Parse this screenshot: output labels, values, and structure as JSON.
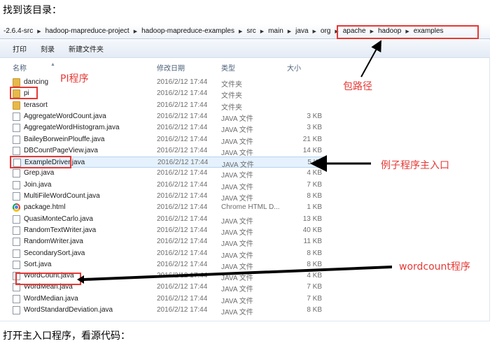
{
  "headings": {
    "top": "找到该目录：",
    "bottom": "打开主入口程序，看源代码："
  },
  "breadcrumb": [
    "-2.6.4-src",
    "hadoop-mapreduce-project",
    "hadoop-mapreduce-examples",
    "src",
    "main",
    "java",
    "org",
    "apache",
    "hadoop",
    "examples"
  ],
  "toolbar": {
    "print": "打印",
    "burn": "刻录",
    "new_folder": "新建文件夹"
  },
  "columns": {
    "name": "名称",
    "date": "修改日期",
    "type": "类型",
    "size": "大小"
  },
  "files": [
    {
      "name": "dancing",
      "date": "2016/2/12 17:44",
      "type": "文件夹",
      "size": "",
      "icon": "folder-icon"
    },
    {
      "name": "pi",
      "date": "2016/2/12 17:44",
      "type": "文件夹",
      "size": "",
      "icon": "folder-icon"
    },
    {
      "name": "terasort",
      "date": "2016/2/12 17:44",
      "type": "文件夹",
      "size": "",
      "icon": "folder-icon"
    },
    {
      "name": "AggregateWordCount.java",
      "date": "2016/2/12 17:44",
      "type": "JAVA 文件",
      "size": "3 KB",
      "icon": "file-icon"
    },
    {
      "name": "AggregateWordHistogram.java",
      "date": "2016/2/12 17:44",
      "type": "JAVA 文件",
      "size": "3 KB",
      "icon": "file-icon"
    },
    {
      "name": "BaileyBorweinPlouffe.java",
      "date": "2016/2/12 17:44",
      "type": "JAVA 文件",
      "size": "21 KB",
      "icon": "file-icon"
    },
    {
      "name": "DBCountPageView.java",
      "date": "2016/2/12 17:44",
      "type": "JAVA 文件",
      "size": "14 KB",
      "icon": "file-icon"
    },
    {
      "name": "ExampleDriver.java",
      "date": "2016/2/12 17:44",
      "type": "JAVA 文件",
      "size": "5 KB",
      "icon": "file-icon"
    },
    {
      "name": "Grep.java",
      "date": "2016/2/12 17:44",
      "type": "JAVA 文件",
      "size": "4 KB",
      "icon": "file-icon"
    },
    {
      "name": "Join.java",
      "date": "2016/2/12 17:44",
      "type": "JAVA 文件",
      "size": "7 KB",
      "icon": "file-icon"
    },
    {
      "name": "MultiFileWordCount.java",
      "date": "2016/2/12 17:44",
      "type": "JAVA 文件",
      "size": "8 KB",
      "icon": "file-icon"
    },
    {
      "name": "package.html",
      "date": "2016/2/12 17:44",
      "type": "Chrome HTML D...",
      "size": "1 KB",
      "icon": "chrome-icon"
    },
    {
      "name": "QuasiMonteCarlo.java",
      "date": "2016/2/12 17:44",
      "type": "JAVA 文件",
      "size": "13 KB",
      "icon": "file-icon"
    },
    {
      "name": "RandomTextWriter.java",
      "date": "2016/2/12 17:44",
      "type": "JAVA 文件",
      "size": "40 KB",
      "icon": "file-icon"
    },
    {
      "name": "RandomWriter.java",
      "date": "2016/2/12 17:44",
      "type": "JAVA 文件",
      "size": "11 KB",
      "icon": "file-icon"
    },
    {
      "name": "SecondarySort.java",
      "date": "2016/2/12 17:44",
      "type": "JAVA 文件",
      "size": "8 KB",
      "icon": "file-icon"
    },
    {
      "name": "Sort.java",
      "date": "2016/2/12 17:44",
      "type": "JAVA 文件",
      "size": "8 KB",
      "icon": "file-icon"
    },
    {
      "name": "WordCount.java",
      "date": "2016/2/12 17:44",
      "type": "JAVA 文件",
      "size": "4 KB",
      "icon": "file-icon"
    },
    {
      "name": "WordMean.java",
      "date": "2016/2/12 17:44",
      "type": "JAVA 文件",
      "size": "7 KB",
      "icon": "file-icon"
    },
    {
      "name": "WordMedian.java",
      "date": "2016/2/12 17:44",
      "type": "JAVA 文件",
      "size": "7 KB",
      "icon": "file-icon"
    },
    {
      "name": "WordStandardDeviation.java",
      "date": "2016/2/12 17:44",
      "type": "JAVA 文件",
      "size": "8 KB",
      "icon": "file-icon"
    }
  ],
  "selected_file": "ExampleDriver.java",
  "annotations": {
    "pi_program": "PI程序",
    "package_path": "包路径",
    "main_entry": "例子程序主入口",
    "wordcount_program": "wordcount程序"
  },
  "colors": {
    "annotation_red": "#e53935",
    "selection_blue": "#e5f1fc"
  }
}
